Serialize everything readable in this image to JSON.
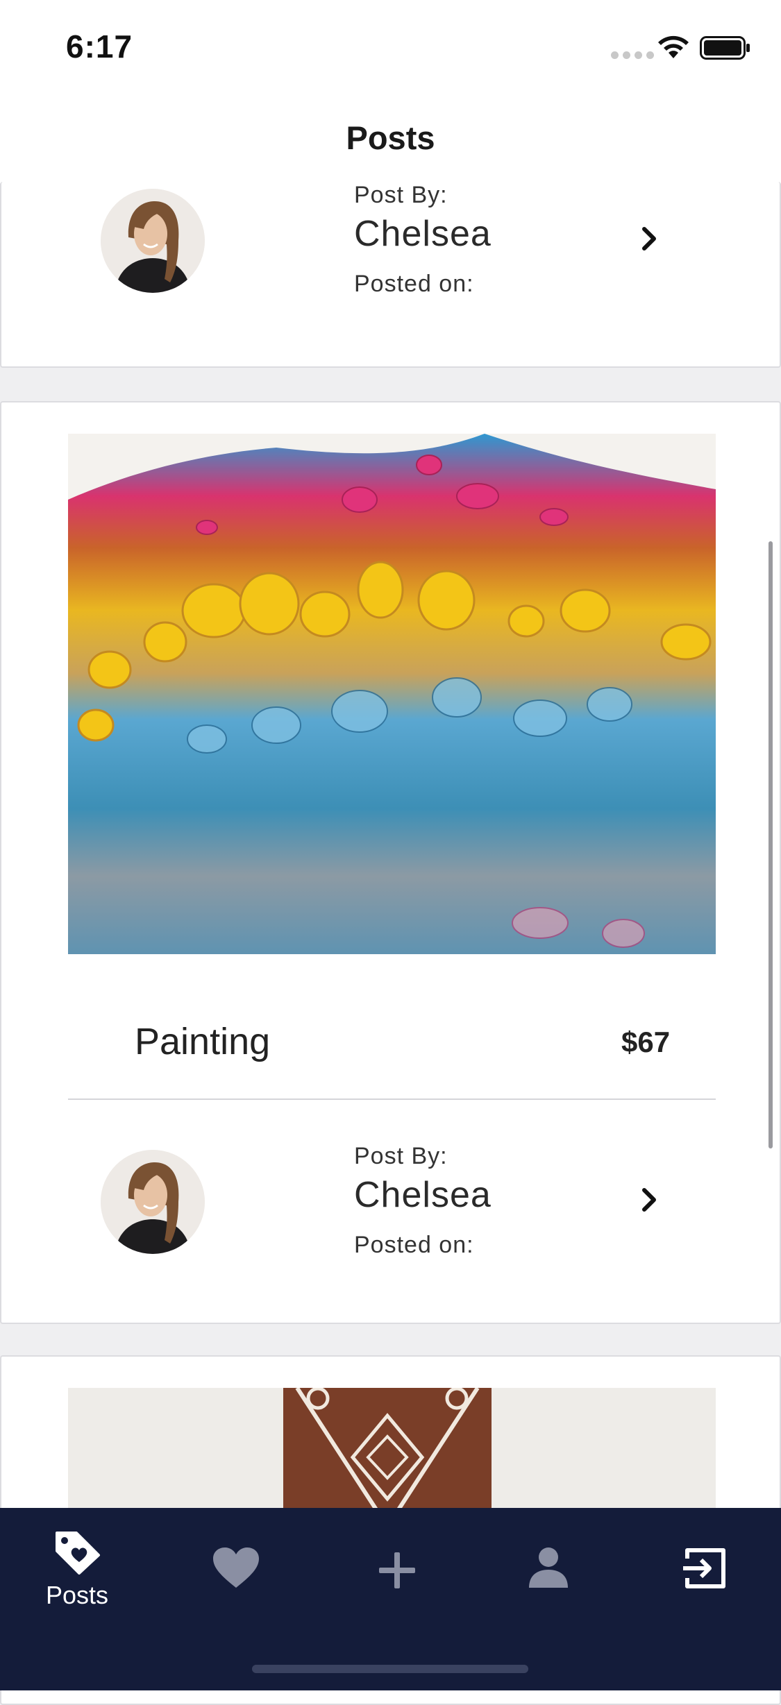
{
  "status_bar": {
    "time": "6:17"
  },
  "nav": {
    "title": "Posts"
  },
  "posts": [
    {
      "author_label": "Post By:",
      "author": "Chelsea",
      "posted_label": "Posted on:"
    },
    {
      "title": "Painting",
      "price": "$67",
      "author_label": "Post By:",
      "author": "Chelsea",
      "posted_label": "Posted on:"
    }
  ],
  "tabs": [
    {
      "label": "Posts",
      "icon": "tag-heart-icon"
    },
    {
      "label": "",
      "icon": "heart-icon"
    },
    {
      "label": "",
      "icon": "plus-icon"
    },
    {
      "label": "",
      "icon": "person-icon"
    },
    {
      "label": "",
      "icon": "logout-icon"
    }
  ],
  "colors": {
    "tab_bar_bg": "#141c3a",
    "tab_inactive": "#8a8fa3",
    "tab_active": "#ffffff"
  }
}
